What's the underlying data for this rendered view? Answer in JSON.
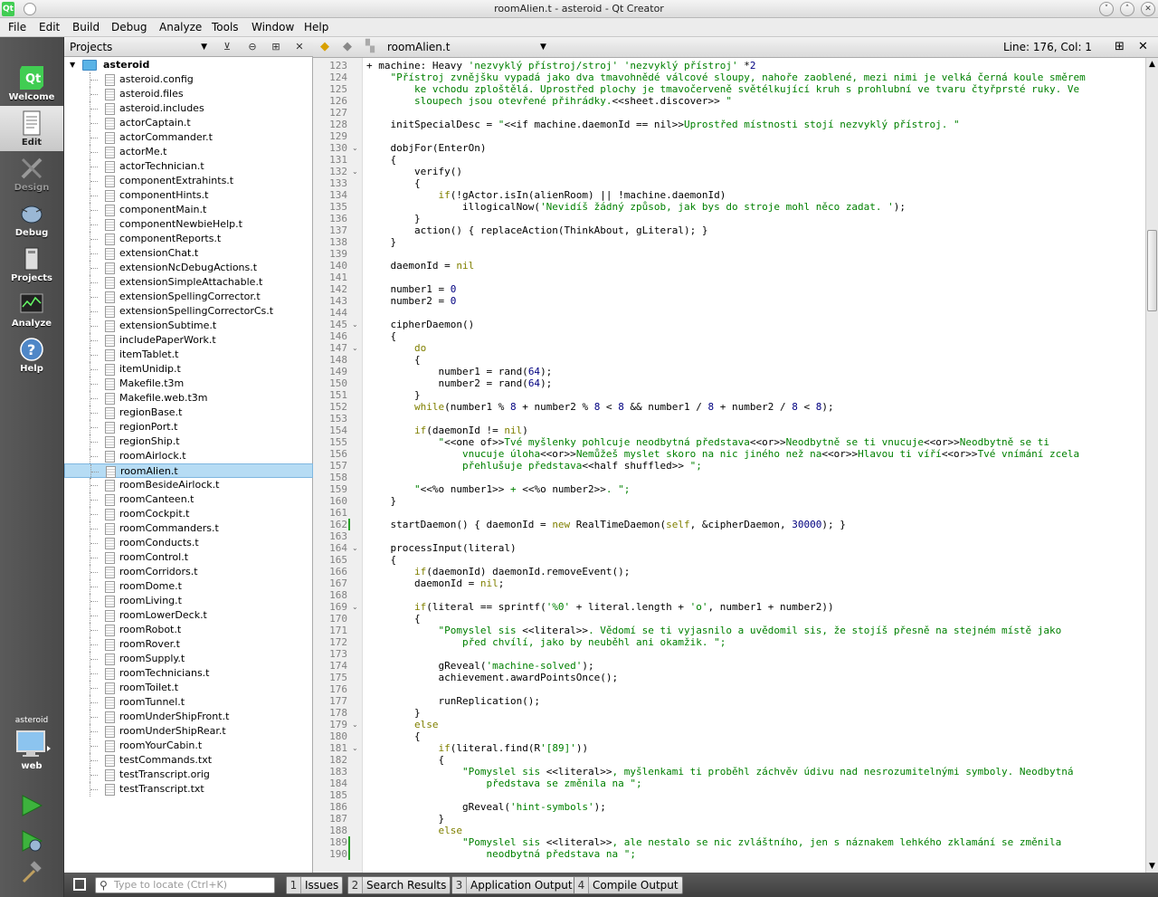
{
  "window": {
    "title": "roomAlien.t - asteroid - Qt Creator",
    "app_icon": "Qt"
  },
  "menu": [
    "File",
    "Edit",
    "Build",
    "Debug",
    "Analyze",
    "Tools",
    "Window",
    "Help"
  ],
  "modes": [
    {
      "label": "Welcome",
      "icon": "qt-logo-icon",
      "state": "normal"
    },
    {
      "label": "Edit",
      "icon": "document-edit-icon",
      "state": "active"
    },
    {
      "label": "Design",
      "icon": "design-pencil-icon",
      "state": "disabled"
    },
    {
      "label": "Debug",
      "icon": "bug-icon",
      "state": "normal"
    },
    {
      "label": "Projects",
      "icon": "projects-icon",
      "state": "normal"
    },
    {
      "label": "Analyze",
      "icon": "analyze-icon",
      "state": "normal"
    },
    {
      "label": "Help",
      "icon": "help-icon",
      "state": "normal"
    }
  ],
  "kit": {
    "project": "asteroid",
    "target": "web"
  },
  "projects_pane": {
    "combo_label": "Projects",
    "root": "asteroid",
    "selected": "roomAlien.t",
    "files": [
      "asteroid.config",
      "asteroid.files",
      "asteroid.includes",
      "actorCaptain.t",
      "actorCommander.t",
      "actorMe.t",
      "actorTechnician.t",
      "componentExtrahints.t",
      "componentHints.t",
      "componentMain.t",
      "componentNewbieHelp.t",
      "componentReports.t",
      "extensionChat.t",
      "extensionNcDebugActions.t",
      "extensionSimpleAttachable.t",
      "extensionSpellingCorrector.t",
      "extensionSpellingCorrectorCs.t",
      "extensionSubtime.t",
      "includePaperWork.t",
      "itemTablet.t",
      "itemUnidip.t",
      "Makefile.t3m",
      "Makefile.web.t3m",
      "regionBase.t",
      "regionPort.t",
      "regionShip.t",
      "roomAirlock.t",
      "roomAlien.t",
      "roomBesideAirlock.t",
      "roomCanteen.t",
      "roomCockpit.t",
      "roomCommanders.t",
      "roomConducts.t",
      "roomControl.t",
      "roomCorridors.t",
      "roomDome.t",
      "roomLiving.t",
      "roomLowerDeck.t",
      "roomRobot.t",
      "roomRover.t",
      "roomSupply.t",
      "roomTechnicians.t",
      "roomToilet.t",
      "roomTunnel.t",
      "roomUnderShipFront.t",
      "roomUnderShipRear.t",
      "roomYourCabin.t",
      "testCommands.txt",
      "testTranscript.orig",
      "testTranscript.txt"
    ]
  },
  "editor": {
    "filename": "roomAlien.t",
    "position": "Line: 176, Col: 1",
    "lines": [
      {
        "n": "123",
        "html": "+ machine: Heavy <span class=\"s\">'nezvyklý přístroj/stroj'</span> <span class=\"s\">'nezvyklý přístroj'</span> *<span class=\"n\">2</span>"
      },
      {
        "n": "124",
        "html": "    <span class=\"s\">\"Přístroj zvnějšku vypadá jako dva tmavohnědé válcové sloupy, nahoře zaoblené, mezi nimi je velká černá koule směrem</span>"
      },
      {
        "n": "125",
        "html": "        <span class=\"s\">ke vchodu zploštělá. Uprostřed plochy je tmavočerveně světélkující kruh s prohlubní ve tvaru čtyřprsté ruky. Ve</span>"
      },
      {
        "n": "126",
        "html": "        <span class=\"s\">sloupech jsou otevřené přihrádky.</span>&lt;&lt;sheet.discover&gt;&gt; <span class=\"s\">\"</span>"
      },
      {
        "n": "127",
        "html": ""
      },
      {
        "n": "128",
        "html": "    initSpecialDesc = <span class=\"s\">\"</span>&lt;&lt;if machine.daemonId == nil&gt;&gt;<span class=\"s\">Uprostřed místnosti stojí nezvyklý přístroj. \"</span>"
      },
      {
        "n": "129",
        "html": ""
      },
      {
        "n": "130",
        "html": "    dobjFor(EnterOn)",
        "fold": true
      },
      {
        "n": "131",
        "html": "    {"
      },
      {
        "n": "132",
        "html": "        verify()",
        "fold": true
      },
      {
        "n": "133",
        "html": "        {"
      },
      {
        "n": "134",
        "html": "            <span class=\"k\">if</span>(!gActor.isIn(alienRoom) || !machine.daemonId)"
      },
      {
        "n": "135",
        "html": "                illogicalNow(<span class=\"s\">'Nevidíš žádný způsob, jak bys do stroje mohl něco zadat. '</span>);"
      },
      {
        "n": "136",
        "html": "        }"
      },
      {
        "n": "137",
        "html": "        action() { replaceAction(ThinkAbout, gLiteral); }"
      },
      {
        "n": "138",
        "html": "    }"
      },
      {
        "n": "139",
        "html": ""
      },
      {
        "n": "140",
        "html": "    daemonId = <span class=\"k\">nil</span>"
      },
      {
        "n": "141",
        "html": ""
      },
      {
        "n": "142",
        "html": "    number1 = <span class=\"n\">0</span>"
      },
      {
        "n": "143",
        "html": "    number2 = <span class=\"n\">0</span>"
      },
      {
        "n": "144",
        "html": ""
      },
      {
        "n": "145",
        "html": "    cipherDaemon()",
        "fold": true
      },
      {
        "n": "146",
        "html": "    {"
      },
      {
        "n": "147",
        "html": "        <span class=\"k\">do</span>",
        "fold": true
      },
      {
        "n": "148",
        "html": "        {"
      },
      {
        "n": "149",
        "html": "            number1 = rand(<span class=\"n\">64</span>);"
      },
      {
        "n": "150",
        "html": "            number2 = rand(<span class=\"n\">64</span>);"
      },
      {
        "n": "151",
        "html": "        }"
      },
      {
        "n": "152",
        "html": "        <span class=\"k\">while</span>(number1 % <span class=\"n\">8</span> + number2 % <span class=\"n\">8</span> &lt; <span class=\"n\">8</span> &amp;&amp; number1 / <span class=\"n\">8</span> + number2 / <span class=\"n\">8</span> &lt; <span class=\"n\">8</span>);"
      },
      {
        "n": "153",
        "html": ""
      },
      {
        "n": "154",
        "html": "        <span class=\"k\">if</span>(daemonId != <span class=\"k\">nil</span>)"
      },
      {
        "n": "155",
        "html": "            <span class=\"s\">\"</span>&lt;&lt;one of&gt;&gt;<span class=\"s\">Tvé myšlenky pohlcuje neodbytná představa</span>&lt;&lt;or&gt;&gt;<span class=\"s\">Neodbytně se ti vnucuje</span>&lt;&lt;or&gt;&gt;<span class=\"s\">Neodbytně se ti</span>"
      },
      {
        "n": "156",
        "html": "                <span class=\"s\">vnucuje úloha</span>&lt;&lt;or&gt;&gt;<span class=\"s\">Nemůžeš myslet skoro na nic jiného než na</span>&lt;&lt;or&gt;&gt;<span class=\"s\">Hlavou ti víří</span>&lt;&lt;or&gt;&gt;<span class=\"s\">Tvé vnímání zcela</span>"
      },
      {
        "n": "157",
        "html": "                <span class=\"s\">přehlušuje představa</span>&lt;&lt;half shuffled&gt;&gt; <span class=\"s\">\";</span>"
      },
      {
        "n": "158",
        "html": ""
      },
      {
        "n": "159",
        "html": "        <span class=\"s\">\"</span>&lt;&lt;%o number1&gt;&gt; <span class=\"s\">+</span> &lt;&lt;%o number2&gt;&gt;<span class=\"s\">. \";</span>"
      },
      {
        "n": "160",
        "html": "    }"
      },
      {
        "n": "161",
        "html": ""
      },
      {
        "n": "162",
        "html": "    startDaemon() { daemonId = <span class=\"k\">new</span> RealTimeDaemon(<span class=\"k\">self</span>, &amp;cipherDaemon, <span class=\"n\">30000</span>); }",
        "changed": true
      },
      {
        "n": "163",
        "html": ""
      },
      {
        "n": "164",
        "html": "    processInput(literal)",
        "fold": true
      },
      {
        "n": "165",
        "html": "    {"
      },
      {
        "n": "166",
        "html": "        <span class=\"k\">if</span>(daemonId) daemonId.removeEvent();"
      },
      {
        "n": "167",
        "html": "        daemonId = <span class=\"k\">nil</span>;"
      },
      {
        "n": "168",
        "html": ""
      },
      {
        "n": "169",
        "html": "        <span class=\"k\">if</span>(literal == sprintf(<span class=\"s\">'%0'</span> + literal.length + <span class=\"s\">'o'</span>, number1 + number2))",
        "fold": true
      },
      {
        "n": "170",
        "html": "        {"
      },
      {
        "n": "171",
        "html": "            <span class=\"s\">\"Pomyslel sis </span>&lt;&lt;literal&gt;&gt;<span class=\"s\">. Vědomí se ti vyjasnilo a uvědomil sis, že stojíš přesně na stejném místě jako</span>"
      },
      {
        "n": "172",
        "html": "                <span class=\"s\">před chvílí, jako by neuběhl ani okamžik. \";</span>"
      },
      {
        "n": "173",
        "html": ""
      },
      {
        "n": "174",
        "html": "            gReveal(<span class=\"s\">'machine-solved'</span>);"
      },
      {
        "n": "175",
        "html": "            achievement.awardPointsOnce();"
      },
      {
        "n": "176",
        "html": ""
      },
      {
        "n": "177",
        "html": "            runReplication();"
      },
      {
        "n": "178",
        "html": "        }"
      },
      {
        "n": "179",
        "html": "        <span class=\"k\">else</span>",
        "fold": true
      },
      {
        "n": "180",
        "html": "        {"
      },
      {
        "n": "181",
        "html": "            <span class=\"k\">if</span>(literal.find(R<span class=\"s\">'[89]'</span>))",
        "fold": true
      },
      {
        "n": "182",
        "html": "            {"
      },
      {
        "n": "183",
        "html": "                <span class=\"s\">\"Pomyslel sis </span>&lt;&lt;literal&gt;&gt;<span class=\"s\">, myšlenkami ti proběhl záchvěv údivu nad nesrozumitelnými symboly. Neodbytná</span>"
      },
      {
        "n": "184",
        "html": "                    <span class=\"s\">představa se změnila na \";</span>"
      },
      {
        "n": "185",
        "html": ""
      },
      {
        "n": "186",
        "html": "                gReveal(<span class=\"s\">'hint-symbols'</span>);"
      },
      {
        "n": "187",
        "html": "            }"
      },
      {
        "n": "188",
        "html": "            <span class=\"k\">else</span>"
      },
      {
        "n": "189",
        "html": "                <span class=\"s\">\"Pomyslel sis </span>&lt;&lt;literal&gt;&gt;<span class=\"s\">, ale nestalo se nic zvláštního, jen s náznakem lehkého zklamání se změnila</span>",
        "changed": true
      },
      {
        "n": "190",
        "html": "                    <span class=\"s\">neodbytná představa na \";</span>",
        "changed": true
      }
    ]
  },
  "statusbar": {
    "locate_placeholder": "Type to locate (Ctrl+K)",
    "panes": [
      {
        "num": "1",
        "label": "Issues"
      },
      {
        "num": "2",
        "label": "Search Results"
      },
      {
        "num": "3",
        "label": "Application Output"
      },
      {
        "num": "4",
        "label": "Compile Output"
      }
    ]
  }
}
